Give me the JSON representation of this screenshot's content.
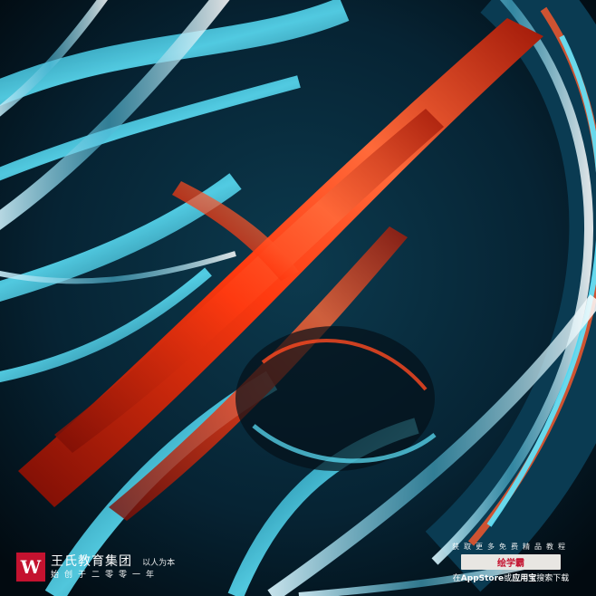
{
  "brand": {
    "logo_letter": "W",
    "name": "王氏教育集团",
    "slogan": "以人为本",
    "sub": "始创于二零零一年"
  },
  "promo": {
    "line1": "获取更多免费精品教程",
    "badge": "绘学霸",
    "line2_prefix": "在",
    "line2_app": "AppStore",
    "line2_mid": "或",
    "line2_store": "应用宝",
    "line2_suffix": "搜索下载"
  },
  "colors": {
    "accent_red": "#ff3a10",
    "accent_cyan": "#1ec8e8",
    "dark": "#06121a",
    "logo_red": "#c4122f"
  }
}
